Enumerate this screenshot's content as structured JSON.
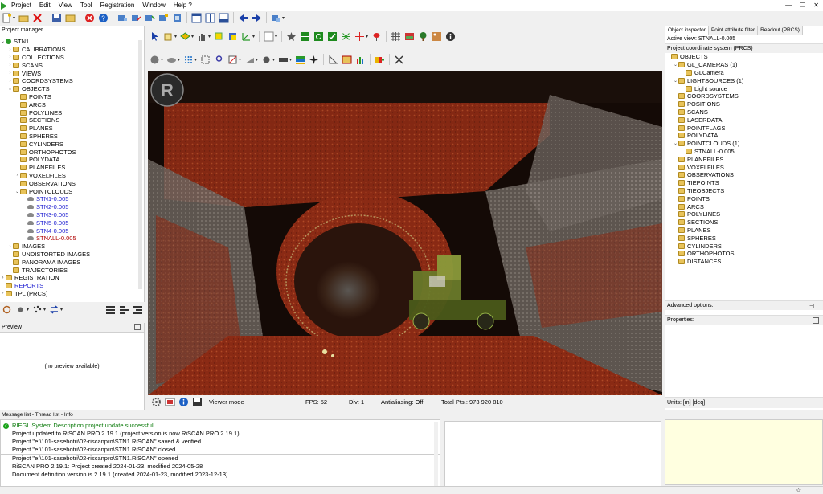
{
  "menu": [
    "Project",
    "Edit",
    "View",
    "Tool",
    "Registration",
    "Window",
    "Help ?"
  ],
  "project_manager": {
    "title": "Project manager",
    "root": "STN1",
    "items": [
      {
        "label": "CALIBRATIONS",
        "level": 1,
        "expander": "›"
      },
      {
        "label": "COLLECTIONS",
        "level": 1,
        "expander": "›"
      },
      {
        "label": "SCANS",
        "level": 1,
        "expander": "›"
      },
      {
        "label": "VIEWS",
        "level": 1,
        "expander": "›"
      },
      {
        "label": "COORDSYSTEMS",
        "level": 1,
        "expander": "›"
      },
      {
        "label": "OBJECTS",
        "level": 1,
        "expander": "⌄"
      },
      {
        "label": "POINTS",
        "level": 2,
        "expander": ""
      },
      {
        "label": "ARCS",
        "level": 2,
        "expander": ""
      },
      {
        "label": "POLYLINES",
        "level": 2,
        "expander": ""
      },
      {
        "label": "SECTIONS",
        "level": 2,
        "expander": ""
      },
      {
        "label": "PLANES",
        "level": 2,
        "expander": ""
      },
      {
        "label": "SPHERES",
        "level": 2,
        "expander": ""
      },
      {
        "label": "CYLINDERS",
        "level": 2,
        "expander": ""
      },
      {
        "label": "ORTHOPHOTOS",
        "level": 2,
        "expander": ""
      },
      {
        "label": "POLYDATA",
        "level": 2,
        "expander": ""
      },
      {
        "label": "PLANEFILES",
        "level": 2,
        "expander": ""
      },
      {
        "label": "VOXELFILES",
        "level": 2,
        "expander": "›"
      },
      {
        "label": "OBSERVATIONS",
        "level": 2,
        "expander": ""
      },
      {
        "label": "POINTCLOUDS",
        "level": 2,
        "expander": "⌄"
      },
      {
        "label": "STN1-0.005",
        "level": 3,
        "expander": "",
        "kind": "cloud",
        "color": "blue"
      },
      {
        "label": "STN2-0.005",
        "level": 3,
        "expander": "",
        "kind": "cloud",
        "color": "blue"
      },
      {
        "label": "STN3-0.005",
        "level": 3,
        "expander": "",
        "kind": "cloud",
        "color": "blue"
      },
      {
        "label": "STN5-0.005",
        "level": 3,
        "expander": "",
        "kind": "cloud",
        "color": "blue"
      },
      {
        "label": "STN4-0.005",
        "level": 3,
        "expander": "",
        "kind": "cloud",
        "color": "blue"
      },
      {
        "label": "STNALL-0.005",
        "level": 3,
        "expander": "",
        "kind": "cloud",
        "color": "red"
      },
      {
        "label": "IMAGES",
        "level": 1,
        "expander": "›"
      },
      {
        "label": "UNDISTORTED IMAGES",
        "level": 1,
        "expander": ""
      },
      {
        "label": "PANORAMA IMAGES",
        "level": 1,
        "expander": ""
      },
      {
        "label": "TRAJECTORIES",
        "level": 1,
        "expander": ""
      },
      {
        "label": "REGISTRATION",
        "level": 0,
        "expander": "›"
      },
      {
        "label": "REPORTS",
        "level": 0,
        "expander": "",
        "color": "blue"
      },
      {
        "label": "TPL (PRCS)",
        "level": 0,
        "expander": "›"
      }
    ]
  },
  "preview": {
    "title": "Preview",
    "empty_text": "(no preview available)"
  },
  "viewer_status": {
    "mode": "Viewer mode",
    "fps": "FPS: 52",
    "div": "Div: 1",
    "antialiasing": "Antialiasing: Off",
    "total_pts": "Total Pts.: 973 920 810"
  },
  "right_panel": {
    "tabs": [
      "Object inspector",
      "Point attribute filter",
      "Readout (PRCS)"
    ],
    "active_view": "Active view: STNALL-0.005",
    "coord_title": "Project coordinate system (PRCS)",
    "items": [
      {
        "label": "OBJECTS",
        "level": 0,
        "expander": ""
      },
      {
        "label": "GL_CAMERAS (1)",
        "level": 1,
        "expander": "⌄"
      },
      {
        "label": "GLCamera",
        "level": 2,
        "expander": ""
      },
      {
        "label": "LIGHTSOURCES (1)",
        "level": 1,
        "expander": "⌄"
      },
      {
        "label": "Light source",
        "level": 2,
        "expander": ""
      },
      {
        "label": "COORDSYSTEMS",
        "level": 1,
        "expander": ""
      },
      {
        "label": "POSITIONS",
        "level": 1,
        "expander": ""
      },
      {
        "label": "SCANS",
        "level": 1,
        "expander": ""
      },
      {
        "label": "LASERDATA",
        "level": 1,
        "expander": ""
      },
      {
        "label": "POINTFLAGS",
        "level": 1,
        "expander": ""
      },
      {
        "label": "POLYDATA",
        "level": 1,
        "expander": ""
      },
      {
        "label": "POINTCLOUDS (1)",
        "level": 1,
        "expander": "⌄"
      },
      {
        "label": "STNALL-0.005",
        "level": 2,
        "expander": ""
      },
      {
        "label": "PLANEFILES",
        "level": 1,
        "expander": ""
      },
      {
        "label": "VOXELFILES",
        "level": 1,
        "expander": ""
      },
      {
        "label": "OBSERVATIONS",
        "level": 1,
        "expander": ""
      },
      {
        "label": "TIEPOINTS",
        "level": 1,
        "expander": ""
      },
      {
        "label": "TIEOBJECTS",
        "level": 1,
        "expander": ""
      },
      {
        "label": "POINTS",
        "level": 1,
        "expander": ""
      },
      {
        "label": "ARCS",
        "level": 1,
        "expander": ""
      },
      {
        "label": "POLYLINES",
        "level": 1,
        "expander": ""
      },
      {
        "label": "SECTIONS",
        "level": 1,
        "expander": ""
      },
      {
        "label": "PLANES",
        "level": 1,
        "expander": ""
      },
      {
        "label": "SPHERES",
        "level": 1,
        "expander": ""
      },
      {
        "label": "CYLINDERS",
        "level": 1,
        "expander": ""
      },
      {
        "label": "ORTHOPHOTOS",
        "level": 1,
        "expander": ""
      },
      {
        "label": "DISTANCES",
        "level": 1,
        "expander": ""
      }
    ],
    "advanced_options": "Advanced options:",
    "properties": "Properties:",
    "units": "Units: [m] [deq]"
  },
  "message_tabs": "Message list - Thread list - Info",
  "messages": [
    {
      "text": "RIEGL System Description project update successful.",
      "kind": "ok"
    },
    {
      "text": "Project updated to RiSCAN PRO 2.19.1 (project version is now RiSCAN PRO 2.19.1)",
      "kind": "normal"
    },
    {
      "text": "Project \"e:\\101-sasebotri\\02-riscanpro\\STN1.RiSCAN\" saved & verified",
      "kind": "normal"
    },
    {
      "text": "Project \"e:\\101-sasebotri\\02-riscanpro\\STN1.RiSCAN\" closed",
      "kind": "normal"
    },
    {
      "text": "Project \"e:\\101-sasebotri\\02-riscanpro\\STN1.RiSCAN\" opened",
      "kind": "normal"
    },
    {
      "text": "RiSCAN PRO 2.19.1: Project created 2024-01-23, modified 2024-05-28",
      "kind": "normal"
    },
    {
      "text": "Document definition version is 2.19.1 (created 2024-01-23, modified 2023-12-13)",
      "kind": "normal"
    }
  ],
  "colors": {
    "accent": "#1a1ad0",
    "selected_cloud": "#b00000",
    "ok": "#1aa31a",
    "viewport_bg": "#1a0f0c"
  }
}
